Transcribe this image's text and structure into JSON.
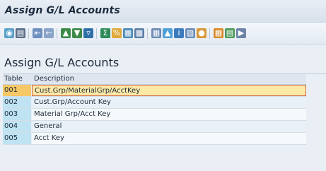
{
  "window": {
    "title": "Assign G/L Accounts"
  },
  "toolbar": {
    "icons": [
      "zoom-icon",
      "sort-icon",
      "first-page-icon",
      "prev-page-icon",
      "sort-asc-icon",
      "sort-desc-icon",
      "filter-icon",
      "sum-icon",
      "subtotal-icon",
      "export-icon",
      "print-icon",
      "spreadsheet-icon",
      "graphic-icon",
      "info-icon",
      "layout-icon",
      "abc-icon",
      "grid-icon",
      "column-icon",
      "more-icon"
    ]
  },
  "main": {
    "title": "Assign G/L Accounts",
    "table": {
      "headers": {
        "key": "Table",
        "description": "Description"
      },
      "rows": [
        {
          "key": "001",
          "description": "Cust.Grp/MaterialGrp/AcctKey",
          "selected": true
        },
        {
          "key": "002",
          "description": "Cust.Grp/Account Key",
          "selected": false
        },
        {
          "key": "003",
          "description": "Material Grp/Acct Key",
          "selected": false
        },
        {
          "key": "004",
          "description": "General",
          "selected": false
        },
        {
          "key": "005",
          "description": "Acct Key",
          "selected": false
        }
      ]
    }
  },
  "colors": {
    "selected_key": "#f6c866",
    "selected_desc": "#fde9a6",
    "key_cell": "#bfe3f2",
    "selection_border": "#d26a4a"
  }
}
